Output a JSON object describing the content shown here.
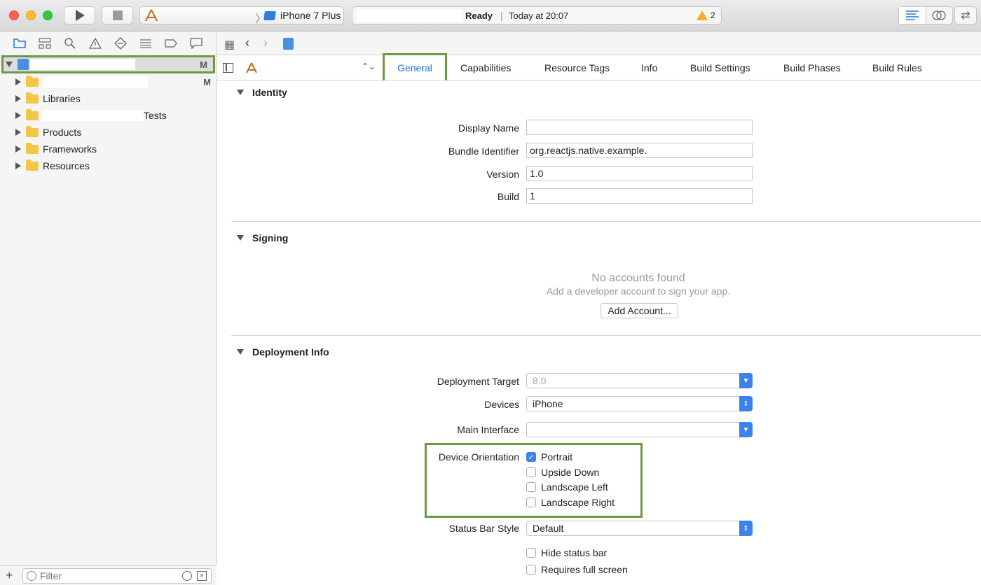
{
  "toolbar": {
    "scheme_device": "iPhone 7 Plus",
    "status": "Ready",
    "separator": "|",
    "status_time": "Today at 20:07",
    "warning_count": "2"
  },
  "navigator": {
    "tree": [
      {
        "label": "",
        "badge": "M"
      },
      {
        "label": "",
        "badge": "M"
      },
      {
        "label": "Libraries"
      },
      {
        "label_suffix": "Tests"
      },
      {
        "label": "Products"
      },
      {
        "label": "Frameworks"
      },
      {
        "label": "Resources"
      }
    ],
    "filter_placeholder": "Filter"
  },
  "tabs": [
    "General",
    "Capabilities",
    "Resource Tags",
    "Info",
    "Build Settings",
    "Build Phases",
    "Build Rules"
  ],
  "identity": {
    "title": "Identity",
    "display_name_label": "Display Name",
    "display_name": "",
    "bundle_id_label": "Bundle Identifier",
    "bundle_id": "org.reactjs.native.example.",
    "version_label": "Version",
    "version": "1.0",
    "build_label": "Build",
    "build": "1"
  },
  "signing": {
    "title": "Signing",
    "no_accounts": "No accounts found",
    "hint": "Add a developer account to sign your app.",
    "add_account": "Add Account..."
  },
  "deployment": {
    "title": "Deployment Info",
    "target_label": "Deployment Target",
    "target": "8.0",
    "devices_label": "Devices",
    "devices": "iPhone",
    "main_interface_label": "Main Interface",
    "main_interface": "",
    "orientation_label": "Device Orientation",
    "orientations": [
      {
        "label": "Portrait",
        "checked": true
      },
      {
        "label": "Upside Down",
        "checked": false
      },
      {
        "label": "Landscape Left",
        "checked": false
      },
      {
        "label": "Landscape Right",
        "checked": false
      }
    ],
    "status_bar_label": "Status Bar Style",
    "status_bar": "Default",
    "hide_status_bar": "Hide status bar",
    "full_screen": "Requires full screen"
  },
  "colors": {
    "accent": "#1a74e8",
    "highlight": "#6a9a43",
    "warning": "#f3b12a"
  }
}
